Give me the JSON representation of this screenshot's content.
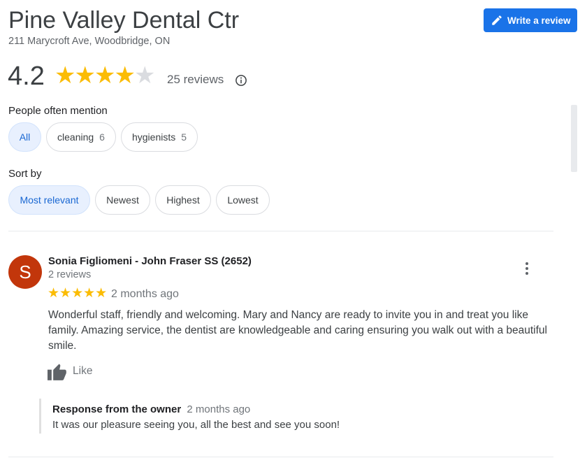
{
  "business": {
    "name": "Pine Valley Dental Ctr",
    "address": "211 Marycroft Ave, Woodbridge, ON"
  },
  "write_review": {
    "label": "Write a review",
    "icon": "pencil-icon"
  },
  "rating": {
    "value": "4.2",
    "stars_filled": 4,
    "stars_total": 5,
    "count_text": "25 reviews"
  },
  "mentions": {
    "label": "People often mention",
    "chips": [
      {
        "label": "All",
        "count": ""
      },
      {
        "label": "cleaning",
        "count": "6"
      },
      {
        "label": "hygienists",
        "count": "5"
      }
    ]
  },
  "sort": {
    "label": "Sort by",
    "options": [
      "Most relevant",
      "Newest",
      "Highest",
      "Lowest"
    ],
    "selected": "Most relevant"
  },
  "review": {
    "avatar_letter": "S",
    "avatar_color": "#c2360b",
    "name": "Sonia Figliomeni - John Fraser SS (2652)",
    "meta": "2 reviews",
    "stars": "★★★★★",
    "date": "2 months ago",
    "text": "Wonderful staff, friendly and welcoming. Mary and Nancy are ready to invite you in and treat you like family. Amazing service, the dentist are knowledgeable and caring ensuring you walk out with a beautiful smile.",
    "like_label": "Like",
    "owner_response": {
      "label": "Response from the owner",
      "date": "2 months ago",
      "text": "It was our pleasure seeing you, all the best and see you soon!"
    }
  },
  "colors": {
    "accent": "#1a73e8",
    "star": "#fbbc04",
    "chip_selected_bg": "#e8f0fe"
  }
}
